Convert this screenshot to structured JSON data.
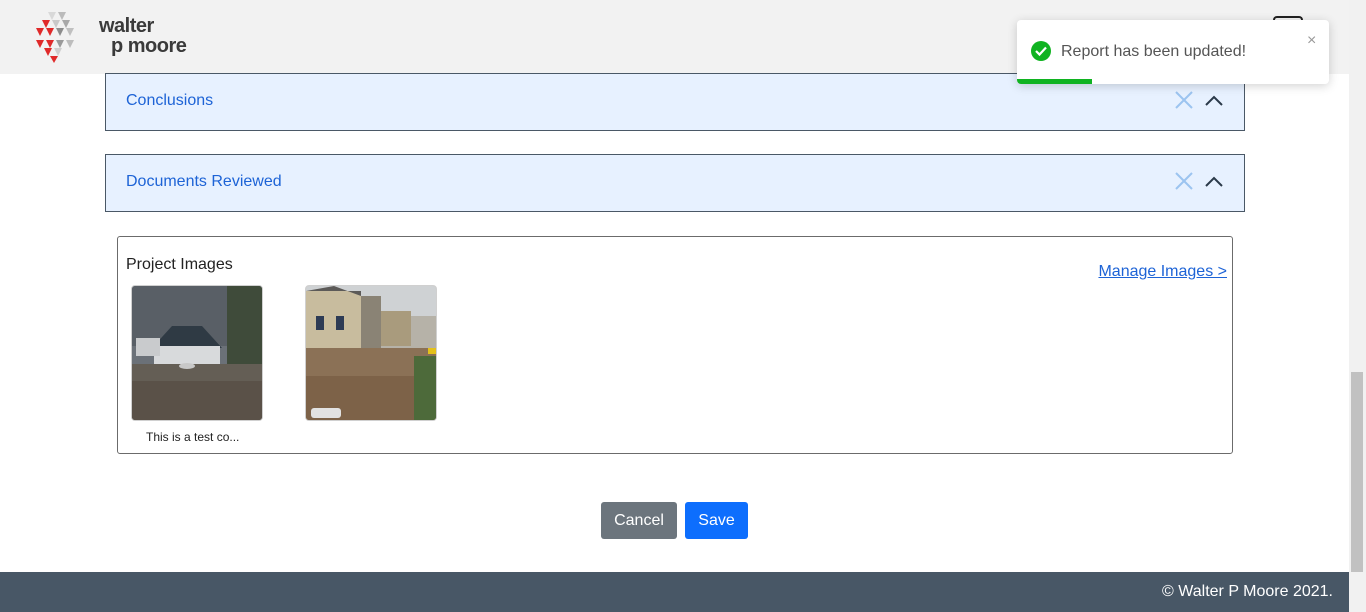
{
  "header": {
    "logo_line1": "walter",
    "logo_line2": "p moore",
    "menu_icon": "menu-icon"
  },
  "sections": [
    {
      "title": "Conclusions",
      "remove_icon": "close-icon",
      "toggle_icon": "chevron-up-icon"
    },
    {
      "title": "Documents Reviewed",
      "remove_icon": "close-icon",
      "toggle_icon": "chevron-up-icon"
    }
  ],
  "project_images": {
    "title": "Project Images",
    "manage_link": "Manage Images >",
    "images": [
      {
        "caption": "This is a test co..."
      },
      {
        "caption": ""
      }
    ]
  },
  "actions": {
    "cancel_label": "Cancel",
    "save_label": "Save"
  },
  "footer": {
    "copyright": "© Walter P Moore 2021."
  },
  "toast": {
    "message": "Report has been updated!",
    "close_glyph": "×",
    "progress": 0.24,
    "success_color": "#10b321"
  },
  "colors": {
    "accent": "#1d63d6",
    "accordion_bg": "#e7f1ff",
    "footer_bg": "#485766"
  }
}
